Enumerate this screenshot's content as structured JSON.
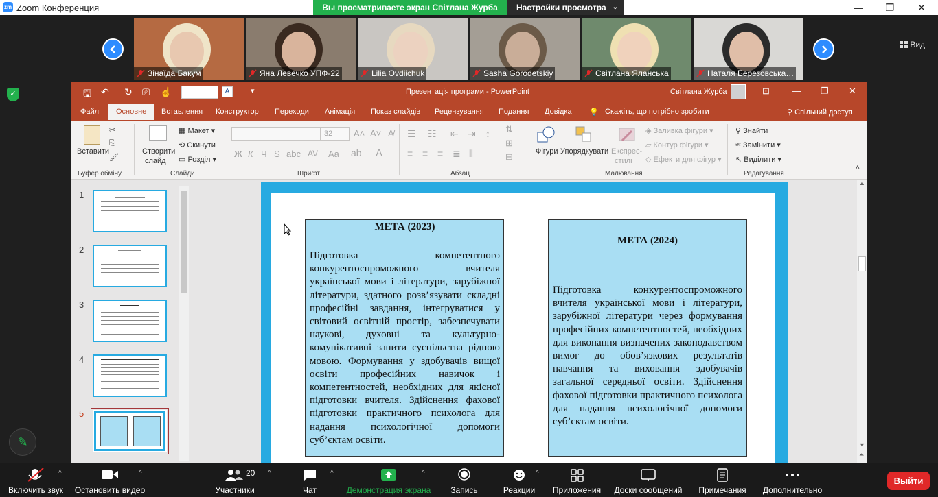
{
  "window": {
    "logo": "zm",
    "title": "Zoom Конференция",
    "minimize": "—",
    "maximize": "❐",
    "close": "✕"
  },
  "share": {
    "banner": "Вы просматриваете экран Світлана Журба",
    "view_options": "Настройки просмотра",
    "view_chevron": "⌄"
  },
  "gallery": {
    "view_label": "Вид",
    "participants": [
      {
        "name": "Зінаїда Бакум",
        "bg": "#b56a42",
        "face": "#e8c8b0",
        "hair": "#efe4c8"
      },
      {
        "name": "Яна Левечко УПФ-22",
        "bg": "#8a7c6e",
        "face": "#d9b49c",
        "hair": "#3a2a20"
      },
      {
        "name": "Lilia Ovdiichuk",
        "bg": "#c9c6c2",
        "face": "#ecd2c0",
        "hair": "#e7d9c0"
      },
      {
        "name": "Sasha Gorodetskiy",
        "bg": "#a49e95",
        "face": "#c9ad98",
        "hair": "#6b5a48"
      },
      {
        "name": "Світлана Яланська",
        "bg": "#6f8a6d",
        "face": "#f0d2bc",
        "hair": "#efe0b2"
      },
      {
        "name": "Наталя Березовська…",
        "bg": "#d9d8d5",
        "face": "#e0bea8",
        "hair": "#2b2b2b"
      }
    ]
  },
  "ppt": {
    "doc_title": "Презентація програми  -  PowerPoint",
    "user": "Світлана Журба",
    "font_size": "32",
    "tabs": [
      "Файл",
      "Основне",
      "Вставлення",
      "Конструктор",
      "Переходи",
      "Анімація",
      "Показ слайдів",
      "Рецензування",
      "Подання",
      "Довідка"
    ],
    "tell_me": "Скажіть, що потрібно зробити",
    "share_access": "Спільний доступ",
    "ribbon": {
      "paste": "Вставити",
      "clipboard_group": "Буфер обміну",
      "new_slide_line1": "Створити",
      "new_slide_line2": "слайд",
      "layout": "Макет",
      "reset": "Скинути",
      "section": "Розділ",
      "slides_group": "Слайди",
      "font_group": "Шрифт",
      "paragraph_group": "Абзац",
      "shapes": "Фігури",
      "arrange": "Упорядкувати",
      "quick_styles_line1": "Експрес-",
      "quick_styles_line2": "стилі",
      "shape_fill": "Заливка фігури",
      "shape_outline": "Контур фігури",
      "shape_effects": "Ефекти для фігур",
      "drawing_group": "Малювання",
      "find": "Знайти",
      "replace": "Замінити",
      "select": "Виділити",
      "editing_group": "Редагування"
    },
    "slide_numbers": [
      "1",
      "2",
      "3",
      "4",
      "5"
    ],
    "slide": {
      "left_title": "МЕТА (2023)",
      "left_text": "Підготовка компетентного конкурентоспроможного вчителя української мови і літератури, зарубіжної літератури, здатного розв’язувати складні професійні завдання, інтегруватися у світовий освітній простір, забезпечувати наукові, духовні та культурно-комунікативні запити суспільства рідною мовою. Формування у здобувачів вищої освіти професійних навичок і компетентностей, необхідних для якісної підготовки вчителя. Здійснення фахової підготовки практичного психолога для надання психологічної допомоги суб’єктам освіти.",
      "right_title": "МЕТА (2024)",
      "right_text": "Підготовка конкурентоспроможного вчителя української мови і літератури, зарубіжної літератури через формування професійних компетентностей, необхідних для виконання визначених законодавством вимог до обов’язкових результатів навчання та виховання здобувачів загальної середньої освіти. Здійснення фахової підготовки практичного психолога для надання психологічної допомоги суб’єктам освіти."
    }
  },
  "toolbar": {
    "mute": "Включить звук",
    "video": "Остановить видео",
    "participants": "Участники",
    "participants_count": "20",
    "chat": "Чат",
    "share": "Демонстрация экрана",
    "record": "Запись",
    "reactions": "Реакции",
    "apps": "Приложения",
    "whiteboards": "Доски сообщений",
    "notes": "Примечания",
    "more": "Дополнительно",
    "exit": "Выйти"
  },
  "colors": {
    "zoom_blue": "#2d8cff",
    "share_green": "#23b14d",
    "ppt_red": "#b7472a",
    "slide_border": "#27aae1",
    "box_fill": "#a9def3",
    "exit_red": "#e02828"
  }
}
